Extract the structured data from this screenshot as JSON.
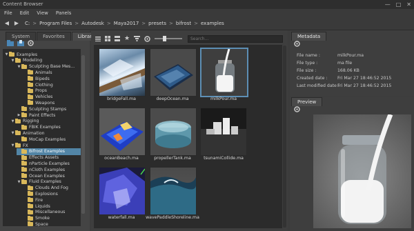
{
  "window": {
    "title": "Content Browser"
  },
  "menu": [
    "File",
    "Edit",
    "View",
    "Panels"
  ],
  "path": [
    "C:",
    "Program Files",
    "Autodesk",
    "Maya2017",
    "presets",
    "bifrost",
    "examples"
  ],
  "left_tabs": [
    "System",
    "Favorites",
    "Library"
  ],
  "tree": [
    {
      "label": "Examples",
      "depth": 0,
      "expanded": true
    },
    {
      "label": "Modeling",
      "depth": 1,
      "expanded": true
    },
    {
      "label": "Sculpting Base Mes...",
      "depth": 2,
      "expanded": true
    },
    {
      "label": "Animals",
      "depth": 3
    },
    {
      "label": "Bipeds",
      "depth": 3
    },
    {
      "label": "Clothing",
      "depth": 3
    },
    {
      "label": "Props",
      "depth": 3
    },
    {
      "label": "Vehicles",
      "depth": 3
    },
    {
      "label": "Weapons",
      "depth": 3
    },
    {
      "label": "Sculpting Stamps",
      "depth": 2
    },
    {
      "label": "Paint Effects",
      "depth": 2,
      "collapsed": true
    },
    {
      "label": "Rigging",
      "depth": 1,
      "expanded": true
    },
    {
      "label": "FBIK Examples",
      "depth": 2
    },
    {
      "label": "Animation",
      "depth": 1,
      "expanded": true
    },
    {
      "label": "MoCap Examples",
      "depth": 2
    },
    {
      "label": "FX",
      "depth": 1,
      "expanded": true
    },
    {
      "label": "Bifrost Examples",
      "depth": 2,
      "selected": true
    },
    {
      "label": "Effects Assets",
      "depth": 2
    },
    {
      "label": "nParticle Examples",
      "depth": 2
    },
    {
      "label": "nCloth Examples",
      "depth": 2
    },
    {
      "label": "Ocean Examples",
      "depth": 2
    },
    {
      "label": "Fluid Examples",
      "depth": 2,
      "expanded": true
    },
    {
      "label": "Clouds And Fog",
      "depth": 3
    },
    {
      "label": "Explosions",
      "depth": 3
    },
    {
      "label": "Fire",
      "depth": 3
    },
    {
      "label": "Liquids",
      "depth": 3
    },
    {
      "label": "Miscellaneous",
      "depth": 3
    },
    {
      "label": "Smoke",
      "depth": 3
    },
    {
      "label": "Space",
      "depth": 3
    }
  ],
  "search": {
    "placeholder": "Search..."
  },
  "files": [
    {
      "name": "bridgeFall.ma",
      "kind": "bridge"
    },
    {
      "name": "deepOcean.ma",
      "kind": "ocean"
    },
    {
      "name": "milkPour.ma",
      "kind": "milk",
      "selected": true
    },
    {
      "name": "oceanBeach.ma",
      "kind": "beach"
    },
    {
      "name": "propellerTank.ma",
      "kind": "tank"
    },
    {
      "name": "tsunamiCollide.ma",
      "kind": "tsunami"
    },
    {
      "name": "waterfall.ma",
      "kind": "waterfall"
    },
    {
      "name": "wavePaddleShoreline.ma",
      "kind": "paddle"
    }
  ],
  "metadata": {
    "tab": "Metadata",
    "rows": [
      {
        "label": "File name :",
        "value": "milkPour.ma"
      },
      {
        "label": "File type :",
        "value": "ma file"
      },
      {
        "label": "File size :",
        "value": "168.06 KB"
      },
      {
        "label": "Created date :",
        "value": "Fri Mar 27 18:46:52 2015"
      },
      {
        "label": "Last modified date :",
        "value": "Fri Mar 27 18:46:52 2015"
      }
    ]
  },
  "preview": {
    "tab": "Preview"
  },
  "colors": {
    "selection": "#5285a6",
    "folder": "#d9b85a",
    "panel_bg": "#444444",
    "dark_bg": "#2b2b2b"
  },
  "icons": [
    "back-icon",
    "forward-icon",
    "grid-view-icon",
    "list-view-icon",
    "star-icon",
    "settings-icon",
    "new-folder-icon",
    "import-icon",
    "gear-icon"
  ]
}
